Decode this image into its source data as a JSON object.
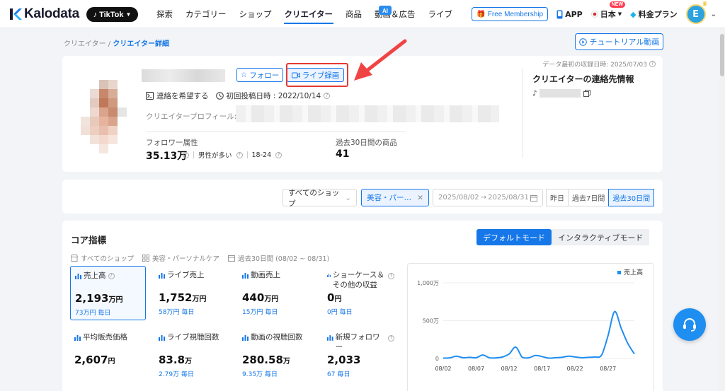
{
  "nav": {
    "logo": "Kalodata",
    "platform": "TikTok",
    "items": [
      "探索",
      "カテゴリー",
      "ショップ",
      "クリエイター",
      "商品",
      "動画＆広告",
      "ライブ"
    ],
    "ai_badge": "AI",
    "membership": "Free Membership",
    "app": "APP",
    "region": "日本",
    "new_badge": "NEW",
    "pricing": "料金プラン",
    "avatar_initial": "E"
  },
  "breadcrumb": {
    "parent": "クリエイター",
    "current": "クリエイター詳細"
  },
  "tutorial_btn": "チュートリアル動画",
  "profile": {
    "follow_btn": "フォロー",
    "live_record_btn": "ライブ録画",
    "contact_request": "連絡を希望する",
    "first_post_label": "初回投稿日時 : 2022/10/14",
    "profile_label": "クリエイタープロフィール:",
    "follower_attr_label": "フォロワー属性",
    "follower_value": "35.13万",
    "gender_label": "男性が多い",
    "age_range": "18-24",
    "products_label": "過去30日間の商品",
    "products_value": "41",
    "collect_date": "データ最初の収録日時: 2025/07/03",
    "contact_title": "クリエイターの連絡先情報"
  },
  "filters": {
    "shop": "すべてのショップ",
    "category": "美容・パー…",
    "date_start": "2025/08/02",
    "date_end": "2025/08/31",
    "ranges": [
      "昨日",
      "過去7日間",
      "過去30日間"
    ]
  },
  "core": {
    "title": "コア指標",
    "mode_default": "デフォルトモード",
    "mode_interactive": "インタラクティブモード",
    "info_shop": "すべてのショップ",
    "info_category": "美容・パーソナルケア",
    "info_period": "過去30日間 (08/02 ~ 08/31)",
    "metrics": [
      {
        "label": "売上高",
        "value": "2,193",
        "unit": "万円",
        "sub": "73万円 毎日"
      },
      {
        "label": "ライブ売上",
        "value": "1,752",
        "unit": "万円",
        "sub": "58万円 毎日"
      },
      {
        "label": "動画売上",
        "value": "440",
        "unit": "万円",
        "sub": "15万円 毎日"
      },
      {
        "label": "ショーケース＆その他の収益",
        "value": "0",
        "unit": "円",
        "sub": "0円 毎日"
      },
      {
        "label": "平均販売価格",
        "value": "2,607",
        "unit": "円",
        "sub": ""
      },
      {
        "label": "ライブ視聴回数",
        "value": "83.8",
        "unit": "万",
        "sub": "2.79万 毎日"
      },
      {
        "label": "動画の視聴回数",
        "value": "280.58",
        "unit": "万",
        "sub": "9.35万 毎日"
      },
      {
        "label": "新規フォロワー",
        "value": "2,033",
        "unit": "",
        "sub": "67 毎日"
      }
    ]
  },
  "chart_data": {
    "type": "line",
    "series": [
      {
        "name": "売上高",
        "x": [
          "08/02",
          "08/03",
          "08/04",
          "08/05",
          "08/06",
          "08/07",
          "08/08",
          "08/09",
          "08/10",
          "08/11",
          "08/12",
          "08/13",
          "08/14",
          "08/15",
          "08/16",
          "08/17",
          "08/18",
          "08/19",
          "08/20",
          "08/21",
          "08/22",
          "08/23",
          "08/24",
          "08/25",
          "08/26",
          "08/27",
          "08/28",
          "08/29",
          "08/30",
          "08/31"
        ],
        "values": [
          5,
          8,
          30,
          10,
          15,
          10,
          45,
          10,
          8,
          20,
          60,
          150,
          15,
          10,
          40,
          25,
          5,
          10,
          15,
          30,
          20,
          10,
          15,
          20,
          40,
          300,
          620,
          400,
          200,
          60
        ]
      }
    ],
    "x_ticks": [
      "08/02",
      "08/07",
      "08/12",
      "08/17",
      "08/22",
      "08/27"
    ],
    "y_ticks": [
      "0",
      "500万",
      "1,000万"
    ],
    "ylim": [
      0,
      1000
    ],
    "legend": "top-right",
    "color": "#1f8ef1"
  }
}
